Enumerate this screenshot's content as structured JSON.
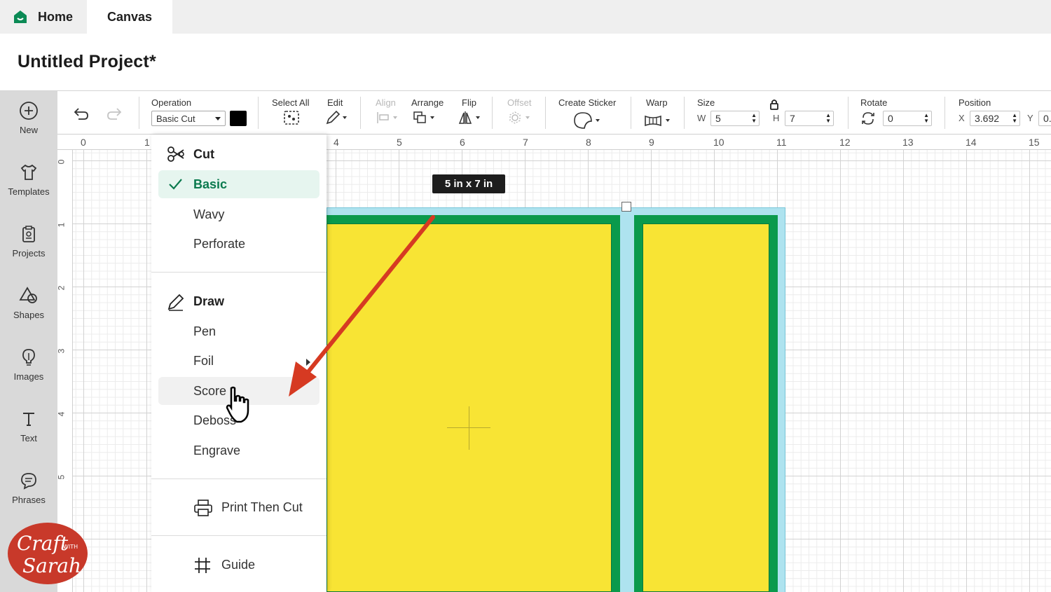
{
  "tabs": {
    "home": "Home",
    "canvas": "Canvas"
  },
  "project": {
    "title": "Untitled Project*"
  },
  "sidebar": {
    "items": [
      {
        "label": "New",
        "icon": "plus-circle-icon"
      },
      {
        "label": "Templates",
        "icon": "tshirt-icon"
      },
      {
        "label": "Projects",
        "icon": "clipboard-icon"
      },
      {
        "label": "Shapes",
        "icon": "shapes-icon"
      },
      {
        "label": "Images",
        "icon": "lightbulb-icon"
      },
      {
        "label": "Text",
        "icon": "text-icon"
      },
      {
        "label": "Phrases",
        "icon": "speech-bubble-icon"
      }
    ]
  },
  "toolbar": {
    "operation_label": "Operation",
    "operation_value": "Basic Cut",
    "operation_color": "#000000",
    "select_all": "Select All",
    "edit": "Edit",
    "align": "Align",
    "arrange": "Arrange",
    "flip": "Flip",
    "offset": "Offset",
    "create_sticker": "Create Sticker",
    "warp": "Warp",
    "size": "Size",
    "w_label": "W",
    "w_value": "5",
    "h_label": "H",
    "h_value": "7",
    "rotate": "Rotate",
    "rotate_value": "0",
    "position": "Position",
    "x_label": "X",
    "x_value": "3.692",
    "y_label": "Y",
    "y_value": "0."
  },
  "ruler": {
    "top": [
      "0",
      "1",
      "4",
      "5",
      "6",
      "7",
      "8",
      "9",
      "10",
      "11",
      "12",
      "13",
      "14",
      "15"
    ],
    "left": [
      "0",
      "1",
      "2",
      "3",
      "4",
      "5"
    ]
  },
  "canvas": {
    "size_tag": "5  in x 7  in",
    "colors": {
      "card_border": "#0a9a4c",
      "card_fill": "#f8e434",
      "selection_fill": "#aee3ef",
      "arrow": "#d63a22"
    }
  },
  "operation_menu": {
    "cut_header": "Cut",
    "cut_options": [
      "Basic",
      "Wavy",
      "Perforate"
    ],
    "selected": "Basic",
    "draw_header": "Draw",
    "draw_options": [
      "Pen",
      "Foil",
      "Score",
      "Deboss",
      "Engrave"
    ],
    "print_then_cut": "Print Then Cut",
    "guide": "Guide"
  },
  "watermark": {
    "line1": "Craft",
    "with": "WITH",
    "line2": "Sarah",
    "color": "#c8392a"
  }
}
